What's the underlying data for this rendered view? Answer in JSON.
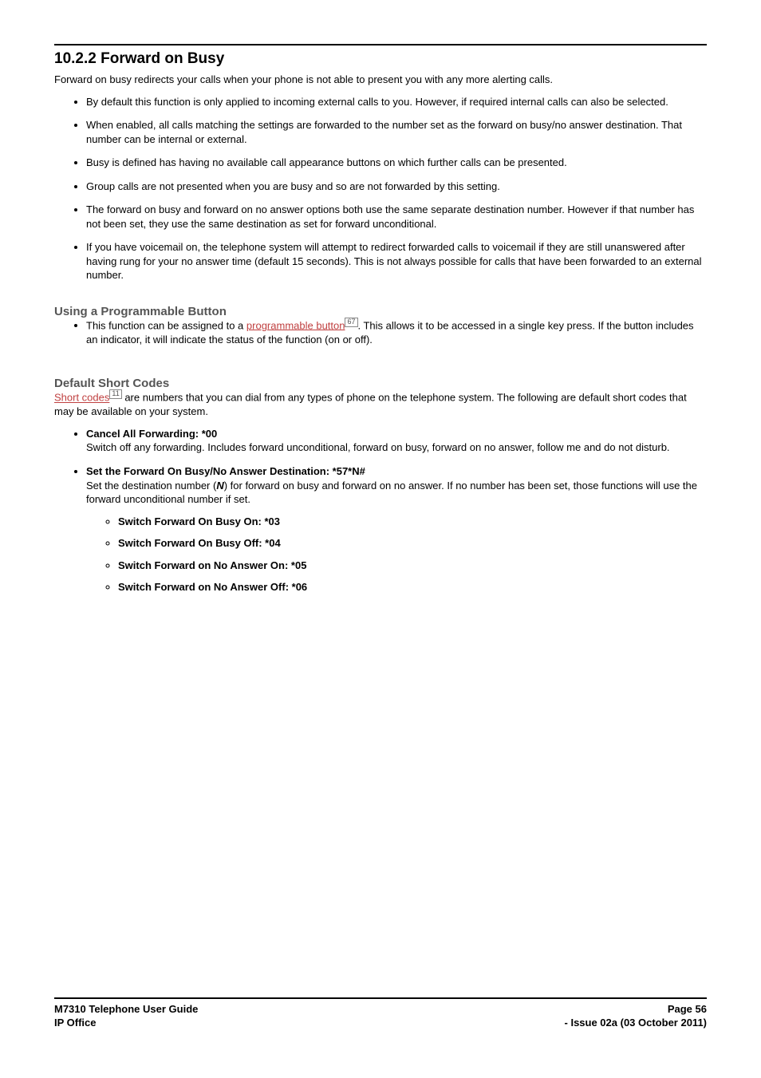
{
  "title": "10.2.2 Forward on Busy",
  "intro": "Forward on busy redirects your calls when your phone is not able to present you with any more alerting calls.",
  "bullets1": [
    "By default this function is only applied to incoming external calls to you. However, if required internal calls can also be selected.",
    "When enabled, all calls matching the settings are forwarded to the number set as the forward on busy/no answer destination. That number can be internal or external.",
    "Busy is defined has having no available call appearance buttons on which further calls can be presented.",
    "Group calls are not presented when you are busy and so are not forwarded by this setting.",
    "The forward on busy and forward on no answer options both use the same separate destination number. However if that number has not been set, they use the same destination as set for forward unconditional.",
    "If you have voicemail on, the telephone system will attempt to redirect forwarded calls to voicemail if they are still unanswered after having rung for your no answer time (default 15 seconds). This is not always possible for calls that have been forwarded to an external number."
  ],
  "sub1_title": "Using a Programmable Button",
  "sub1_prefix": "This function can be assigned to a ",
  "sub1_link": "programmable button",
  "sub1_ref": "67",
  "sub1_suffix": ". This allows it to be accessed in a single key press. If the button includes an indicator, it will indicate the status of the function (on or off).",
  "sub2_title": "Default Short Codes",
  "sub2_link": "Short codes",
  "sub2_ref": "11",
  "sub2_rest": " are numbers that you can dial from any types of phone on the telephone system. The following are default short codes that may be available on your system.",
  "codes": [
    {
      "head": "Cancel All Forwarding: *00",
      "body": "Switch off any forwarding. Includes forward unconditional, forward on busy, forward on no answer, follow me and do not disturb."
    },
    {
      "head": "Set the Forward On Busy/No Answer Destination: *57*N#",
      "body_pre": "Set the destination number (",
      "body_mid": "N",
      "body_post": ") for forward on busy and forward on no answer. If no number has been set, those functions will use the forward unconditional number if set.",
      "sub": [
        "Switch Forward On Busy On: *03",
        "Switch Forward On Busy Off: *04",
        "Switch Forward on No Answer On: *05",
        "Switch Forward on No Answer Off: *06"
      ]
    }
  ],
  "footer": {
    "left1": "M7310 Telephone User Guide",
    "left2": "IP Office",
    "right1": "Page 56",
    "right2": "- Issue 02a (03 October 2011)"
  }
}
